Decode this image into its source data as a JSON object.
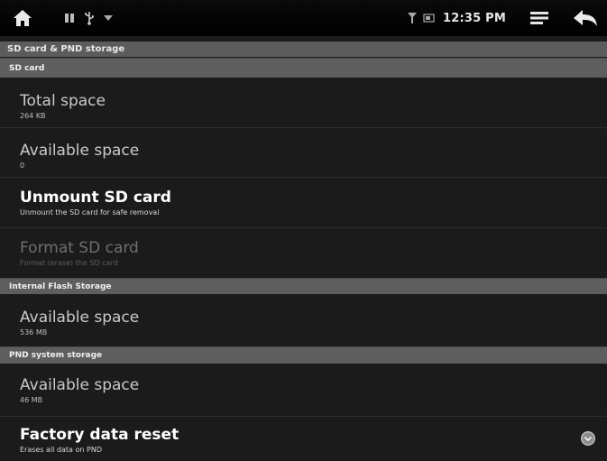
{
  "status_bar": {
    "time": "12:35 PM",
    "icons": [
      "home-icon",
      "notification-icon",
      "usb-icon",
      "signal-icon",
      "signal-strength-icon",
      "battery-icon",
      "menu-icon",
      "back-icon"
    ]
  },
  "title": "SD card & PND storage",
  "sections": {
    "sd_card": {
      "header": "SD card",
      "items": [
        {
          "label": "Total space",
          "sub": "264 KB"
        },
        {
          "label": "Available space",
          "sub": "0"
        },
        {
          "label": "Unmount SD card",
          "sub": "Unmount the SD card for safe removal"
        },
        {
          "label": "Format SD card",
          "sub": "Format (erase) the SD card"
        }
      ]
    },
    "internal_flash": {
      "header": "Internal Flash Storage",
      "items": [
        {
          "label": "Available space",
          "sub": "536 MB"
        }
      ]
    },
    "pnd_system": {
      "header": "PND system storage",
      "items": [
        {
          "label": "Available space",
          "sub": "46 MB"
        },
        {
          "label": "Factory data reset",
          "sub": "Erases all data on PND"
        }
      ]
    }
  }
}
